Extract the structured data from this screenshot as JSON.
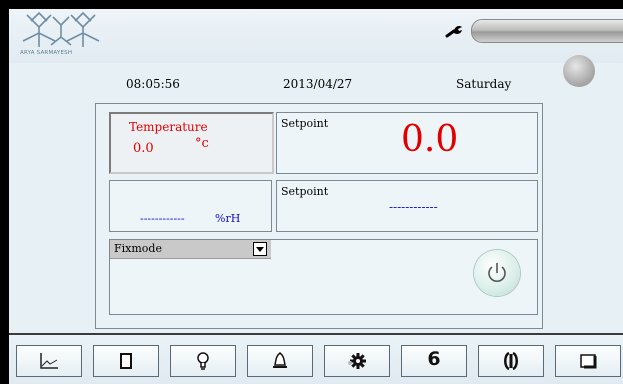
{
  "header": {
    "logo_text": "ARYA SARMAYESH",
    "icons": [
      "snowflake-logo-icon",
      "wrench-icon"
    ]
  },
  "status": {
    "time": "08:05:56",
    "date": "2013/04/27",
    "day": "Saturday"
  },
  "temperature": {
    "label": "Temperature",
    "value": "0.0",
    "unit": "°c"
  },
  "humidity": {
    "value": "------------",
    "unit": "%rH"
  },
  "setpoint_1": {
    "label": "Setpoint",
    "value": "0.0"
  },
  "setpoint_2": {
    "label": "Setpoint",
    "value": "------------"
  },
  "mode": {
    "selected": "Fixmode"
  },
  "toolbar": {
    "buttons": [
      {
        "icon": "chart-icon"
      },
      {
        "icon": "document-icon"
      },
      {
        "icon": "lightbulb-icon"
      },
      {
        "icon": "bell-icon"
      },
      {
        "icon": "gear-icon"
      },
      {
        "icon": "six-icon",
        "label": "6"
      },
      {
        "icon": "rotation-icon"
      },
      {
        "icon": "screen-icon"
      }
    ]
  },
  "colors": {
    "accent_red": "#e00000",
    "value_blue": "#1010c0",
    "background": "#e7f0f5"
  }
}
